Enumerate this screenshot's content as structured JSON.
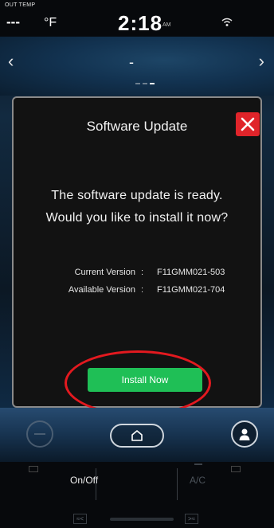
{
  "status": {
    "temp_label": "OUT TEMP",
    "temp_value": "---",
    "temp_unit": "°F",
    "time": "2:18",
    "ampm": "AM"
  },
  "header": {
    "title": "-",
    "page_indicator": {
      "pages": 3,
      "active_index": 2
    }
  },
  "dialog": {
    "title": "Software Update",
    "message_line1": "The software update is ready.",
    "message_line2": "Would you like to install it now?",
    "current_version_label": "Current Version",
    "current_version_value": "F11GMM021-503",
    "available_version_label": "Available Version",
    "available_version_value": "F11GMM021-704",
    "separator": ":",
    "install_label": "Install Now"
  },
  "climate": {
    "onoff_label": "On/Off",
    "ac_label": "A/C"
  },
  "colors": {
    "accent_green": "#1fbf56",
    "close_red": "#e0242a",
    "highlight_red": "#e3191f"
  },
  "icons": [
    "wifi-icon",
    "back-arrow-icon",
    "forward-arrow-icon",
    "close-icon",
    "home-icon",
    "profile-icon"
  ]
}
